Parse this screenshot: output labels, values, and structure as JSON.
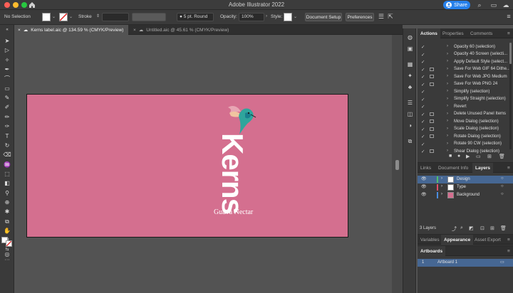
{
  "app": {
    "title": "Adobe Illustrator 2022",
    "share_label": "Share",
    "traffic_colors": [
      "#ff5f57",
      "#febc2e",
      "#28c840"
    ]
  },
  "control_bar": {
    "selection_status": "No Selection",
    "stroke_label": "Stroke",
    "stroke_profile": "5 pt. Round",
    "opacity_label": "Opacity:",
    "opacity_value": "100%",
    "style_label": "Style:",
    "document_setup_label": "Document Setup",
    "preferences_label": "Preferences"
  },
  "tabs": [
    {
      "label": "Kerns label.aic @ 134.59 % (CMYK/Preview)",
      "active": true
    },
    {
      "label": "Untitled.aic @ 45.61 % (CMYK/Preview)",
      "active": false
    }
  ],
  "artboard": {
    "background": "#d46f8f",
    "brand_name": "Kerns",
    "subtitle": "Guava Nectar"
  },
  "actions_panel": {
    "tabs": [
      "Actions",
      "Properties",
      "Comments"
    ],
    "items": [
      "Opacity 60 (selection)",
      "Opacity 40 Screen (selecti...",
      "Apply Default Style (select...",
      "Save For Web GIF 64 Dithe...",
      "Save For Web JPG Medium",
      "Save For Web PNG 24",
      "Simplify (selection)",
      "Simplify Straight (selection)",
      "Revert",
      "Delete Unused Panel Items",
      "Move Dialog (selection)",
      "Scale Dialog (selection)",
      "Rotate Dialog (selection)",
      "Rotate 90 CW (selection)",
      "Shear Dialog (selection)"
    ]
  },
  "layers_panel": {
    "tabs": [
      "Links",
      "Document Info",
      "Layers"
    ],
    "layers": [
      {
        "name": "Design",
        "color": "#4fc06a",
        "selected": true
      },
      {
        "name": "Type",
        "color": "#e0506a",
        "selected": false
      },
      {
        "name": "Background",
        "color": "#4a8de0",
        "selected": false
      }
    ],
    "count_label": "3 Layers"
  },
  "appearance_panel": {
    "tabs": [
      "Variables",
      "Appearance",
      "Asset Export"
    ]
  },
  "artboards_panel": {
    "title": "Artboards",
    "items": [
      {
        "index": "1",
        "name": "Artboard 1"
      }
    ]
  }
}
